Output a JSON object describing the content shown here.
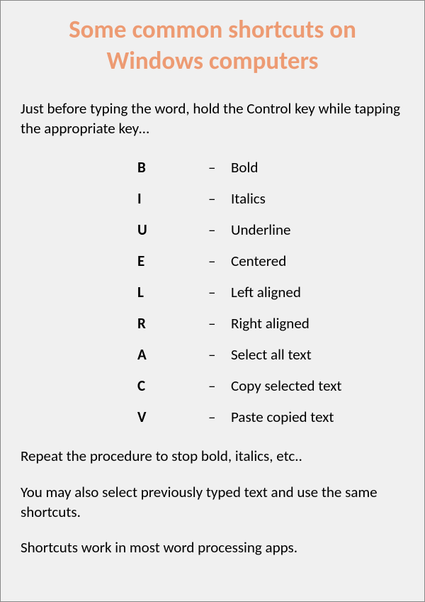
{
  "title": "Some common shortcuts on Windows computers",
  "intro": "Just before typing the word, hold the Control key while tapping the appropriate key…",
  "shortcuts": [
    {
      "key": "B",
      "desc": "Bold"
    },
    {
      "key": "I",
      "desc": "Italics"
    },
    {
      "key": "U",
      "desc": "Underline"
    },
    {
      "key": "E",
      "desc": "Centered"
    },
    {
      "key": "L",
      "desc": "Left aligned"
    },
    {
      "key": "R",
      "desc": "Right aligned"
    },
    {
      "key": "A",
      "desc": "Select all text"
    },
    {
      "key": "C",
      "desc": "Copy selected text"
    },
    {
      "key": "V",
      "desc": "Paste copied text"
    }
  ],
  "dash": "–",
  "notes": [
    "Repeat the procedure to stop bold, italics, etc..",
    "You may also select previously typed text and use the same shortcuts.",
    "Shortcuts work in most word processing apps."
  ]
}
